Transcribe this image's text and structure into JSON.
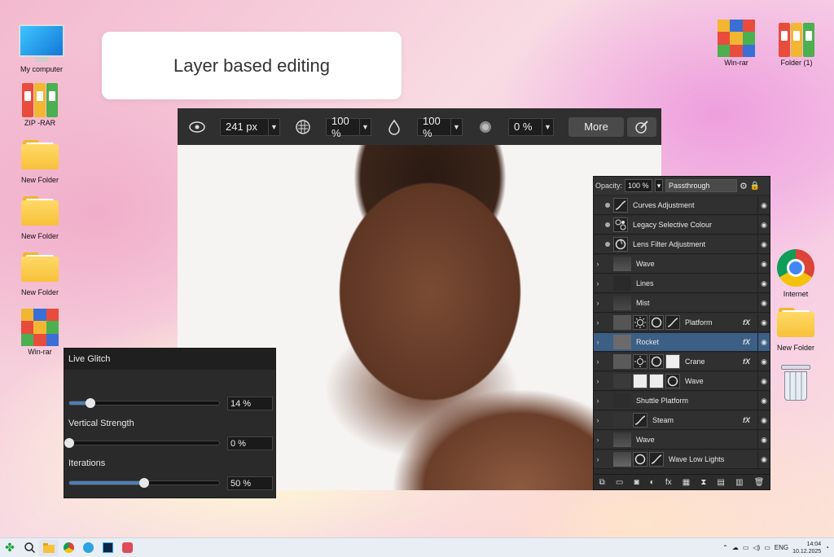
{
  "desktop_left": [
    {
      "label": "My computer",
      "icon": "monitor-icon"
    },
    {
      "label": "ZIP -RAR",
      "icon": "binders-icon"
    },
    {
      "label": "New Folder",
      "icon": "folder-icon"
    },
    {
      "label": "New Folder",
      "icon": "folder-icon"
    },
    {
      "label": "New Folder",
      "icon": "folder-icon"
    },
    {
      "label": "Win-rar",
      "icon": "winrar-icon"
    }
  ],
  "desktop_right": [
    {
      "label": "Win-rar",
      "icon": "winrar-icon"
    },
    {
      "label": "Folder (1)",
      "icon": "binders-icon"
    },
    {
      "label": "Internet",
      "icon": "chrome-icon"
    },
    {
      "label": "New Folder",
      "icon": "folder-icon"
    },
    {
      "label": "",
      "icon": "recycle-bin-icon"
    }
  ],
  "title_card": {
    "text": "Layer based editing"
  },
  "toolbar": {
    "size": "241 px",
    "opacity": "100 %",
    "flow": "100 %",
    "hardness": "0 %",
    "more": "More"
  },
  "layers_panel": {
    "opacity_label": "Opacity:",
    "opacity_value": "100 %",
    "blend_mode": "Passthrough",
    "rows": [
      {
        "name": "Curves Adjustment",
        "fx": ""
      },
      {
        "name": "Legacy Selective Colour",
        "fx": ""
      },
      {
        "name": "Lens Filter Adjustment",
        "fx": ""
      },
      {
        "name": "Wave",
        "fx": ""
      },
      {
        "name": "Lines",
        "fx": ""
      },
      {
        "name": "Mist",
        "fx": ""
      },
      {
        "name": "Platform",
        "fx": "fX"
      },
      {
        "name": "Rocket",
        "fx": "fX"
      },
      {
        "name": "Crane",
        "fx": "fX"
      },
      {
        "name": "Wave",
        "fx": ""
      },
      {
        "name": "Shuttle Platform",
        "fx": ""
      },
      {
        "name": "Steam",
        "fx": "fX"
      },
      {
        "name": "Wave",
        "fx": ""
      },
      {
        "name": "Wave Low Lights",
        "fx": ""
      }
    ],
    "selected_index": 7
  },
  "live_glitch": {
    "title": "Live Glitch",
    "sliders": [
      {
        "label": "",
        "value": "14 %",
        "fraction": 0.14
      },
      {
        "label": "Vertical Strength",
        "value": "0 %",
        "fraction": 0.0
      },
      {
        "label": "Iterations",
        "value": "50 %",
        "fraction": 0.5
      }
    ]
  },
  "taskbar": {
    "lang": "ENG",
    "time": "14:04",
    "date": "10.12.2025"
  },
  "colors": {
    "accent": "#3c5f86",
    "slider_fill": "#4f7fb8",
    "panel_bg": "#2b2b2b"
  }
}
